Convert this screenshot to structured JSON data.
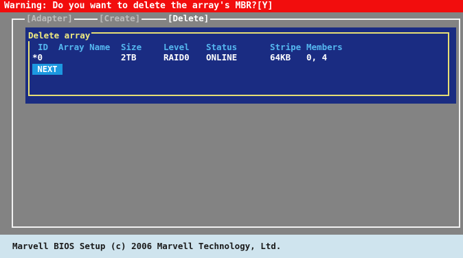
{
  "warning": "Warning: Do you want to delete the array's MBR?[Y]",
  "tabs": [
    {
      "label": "[Adapter]"
    },
    {
      "label": "[Create]"
    },
    {
      "label": "[Delete]"
    }
  ],
  "dialog": {
    "title": "Delete array",
    "columns": [
      "ID",
      "Array Name",
      "Size",
      "Level",
      "Status",
      "Stripe",
      "Members"
    ],
    "rows": [
      {
        "id": "*0",
        "name": "",
        "size": "2TB",
        "level": "RAID0",
        "status": "ONLINE",
        "stripe": "64KB",
        "members": "0, 4"
      }
    ],
    "next_label": "NEXT"
  },
  "footer": "Marvell BIOS Setup (c) 2006 Marvell Technology, Ltd.",
  "colors": {
    "warning_bar": "#f20d0d",
    "background": "#838383",
    "dialog": "#1a2c82",
    "header_text": "#55b7f0",
    "button": "#1c98e0",
    "footer": "#cfe4ee"
  }
}
